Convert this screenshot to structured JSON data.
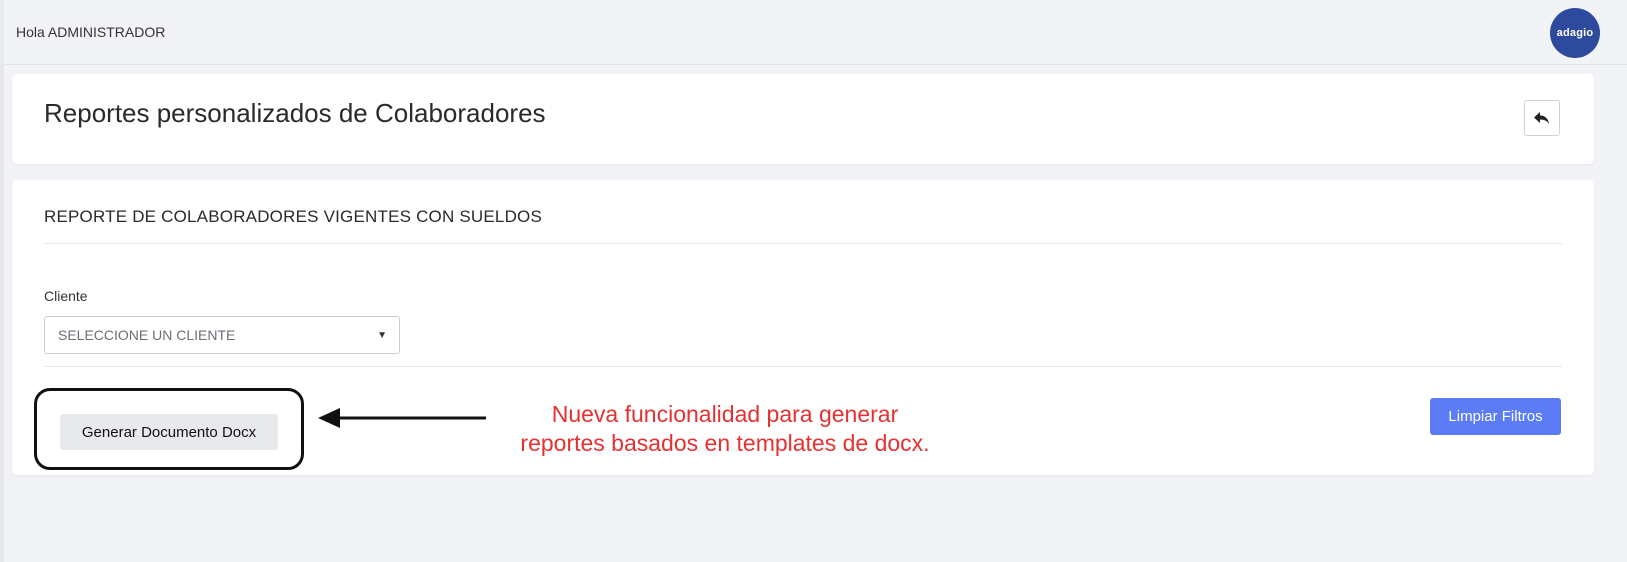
{
  "header": {
    "greeting": "Hola ADMINISTRADOR",
    "logo_text": "adagio"
  },
  "page": {
    "title": "Reportes personalizados de Colaboradores",
    "back_icon": "reply-arrow-icon"
  },
  "report": {
    "section_title": "REPORTE DE COLABORADORES VIGENTES CON SUELDOS",
    "client_label": "Cliente",
    "client_select": "SELECCIONE UN CLIENTE",
    "generate_button": "Generar Documento Docx",
    "clear_button": "Limpiar Filtros"
  },
  "annotation": {
    "line1": "Nueva funcionalidad para generar",
    "line2": "reportes basados en templates de docx."
  },
  "colors": {
    "primary_button": "#5b7cf4",
    "avatar_bg": "#2d4a9c",
    "annotation_text": "#e53131"
  }
}
